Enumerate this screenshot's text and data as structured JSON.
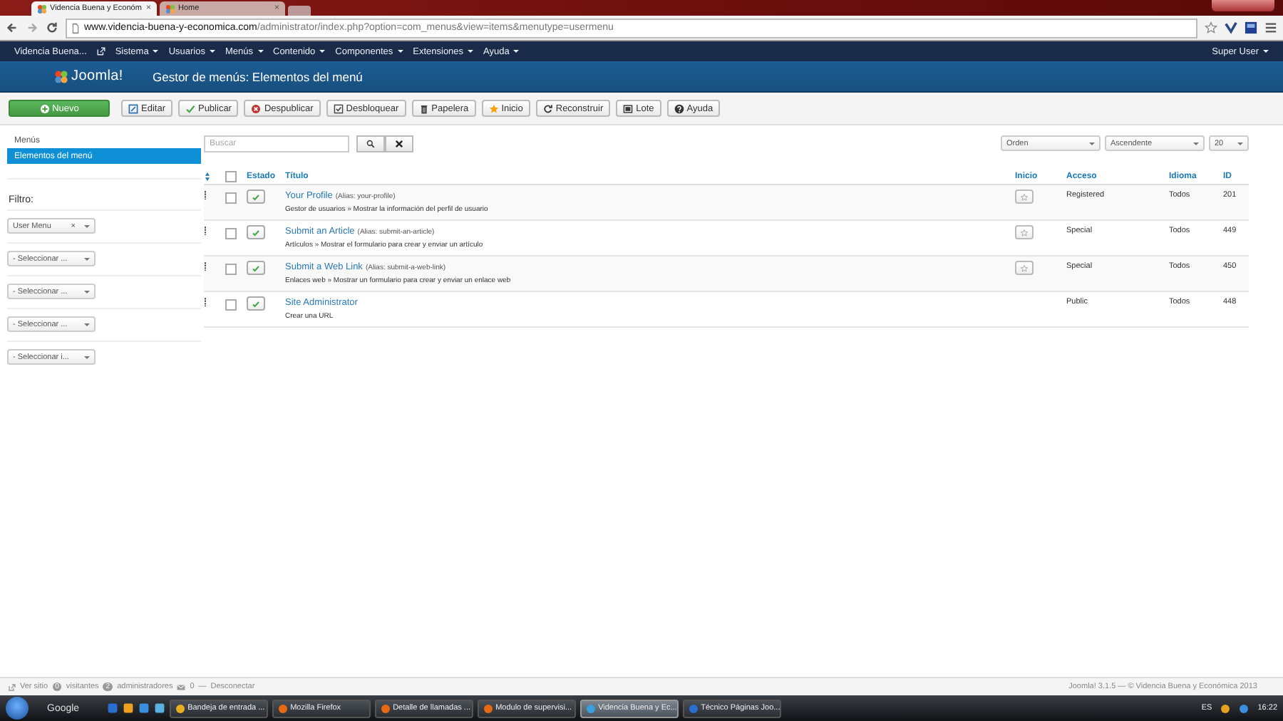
{
  "browser": {
    "tabs": [
      {
        "label": "Videncia Buena y Económ",
        "close": "×",
        "selected": true
      },
      {
        "label": "Home",
        "close": "×",
        "selected": false
      }
    ],
    "url": {
      "domain": "www.videncia-buena-y-economica.com",
      "path": "/administrator/index.php?option=com_menus&view=items&menutype=usermenu"
    }
  },
  "nav": {
    "site": "Videncia Buena...",
    "menus": [
      "Sistema",
      "Usuarios",
      "Menús",
      "Contenido",
      "Componentes",
      "Extensiones",
      "Ayuda"
    ],
    "user": "Super User"
  },
  "header": {
    "logo": "Joomla!",
    "title": "Gestor de menús: Elementos del menú"
  },
  "toolbar": [
    {
      "label": "Nuevo",
      "kind": "new"
    },
    {
      "label": "Editar",
      "kind": "edit"
    },
    {
      "label": "Publicar",
      "kind": "publish"
    },
    {
      "label": "Despublicar",
      "kind": "unpublish"
    },
    {
      "label": "Desbloquear",
      "kind": "checkin"
    },
    {
      "label": "Papelera",
      "kind": "trash"
    },
    {
      "label": "Inicio",
      "kind": "home"
    },
    {
      "label": "Reconstruir",
      "kind": "rebuild"
    },
    {
      "label": "Lote",
      "kind": "batch"
    },
    {
      "label": "Ayuda",
      "kind": "help"
    }
  ],
  "sidebar": {
    "items": [
      {
        "label": "Menús",
        "selected": false
      },
      {
        "label": "Elementos del menú",
        "selected": true
      }
    ],
    "filter_label": "Filtro:",
    "filters": [
      {
        "value": "User Menu",
        "clear": "×"
      },
      {
        "value": "- Seleccionar ..."
      },
      {
        "value": "- Seleccionar ..."
      },
      {
        "value": "- Seleccionar ..."
      },
      {
        "value": "- Seleccionar i..."
      }
    ]
  },
  "search": {
    "placeholder": "Buscar"
  },
  "list_controls": [
    "Orden",
    "Ascendente",
    "20"
  ],
  "table": {
    "select_all_checked": false,
    "columns": [
      "Estado",
      "Título",
      "Inicio",
      "Acceso",
      "Idioma",
      "ID"
    ],
    "rows": [
      {
        "title": "Your Profile",
        "alias": "(Alias: your-profile)",
        "description": "Gestor de usuarios » Mostrar la información del perfil de usuario",
        "checked": false,
        "published": true,
        "home_button": true,
        "access": "Registered",
        "language": "Todos",
        "id": "201"
      },
      {
        "title": "Submit an Article",
        "alias": "(Alias: submit-an-article)",
        "description": "Artículos » Mostrar el formulario para crear y enviar un artículo",
        "checked": false,
        "published": true,
        "home_button": true,
        "access": "Special",
        "language": "Todos",
        "id": "449"
      },
      {
        "title": "Submit a Web Link",
        "alias": "(Alias: submit-a-web-link)",
        "description": "Enlaces web » Mostrar un formulario para crear y enviar un enlace web",
        "checked": false,
        "published": true,
        "home_button": true,
        "access": "Special",
        "language": "Todos",
        "id": "450"
      },
      {
        "title": "Site Administrator",
        "alias": "",
        "description": "Crear una URL",
        "checked": false,
        "published": true,
        "home_button": false,
        "access": "Public",
        "language": "Todos",
        "id": "448"
      }
    ]
  },
  "status_bar": {
    "view_site": "Ver sitio",
    "visitors_count": "0",
    "visitors": "visitantes",
    "admins_count": "2",
    "admins": "administradores",
    "messages_count": "0",
    "separator": "—",
    "logout": "Desconectar",
    "copyright": "Joomla! 3.1.5 — © Videncia Buena y Económica 2013"
  },
  "taskbar": {
    "search": "Google",
    "tasks": [
      {
        "label": "Bandeja de entrada ...",
        "selected": false
      },
      {
        "label": "Mozilla Firefox",
        "selected": false
      },
      {
        "label": "Detalle de llamadas ...",
        "selected": false
      },
      {
        "label": "Modulo de supervisi...",
        "selected": false
      },
      {
        "label": "Videncia Buena y Ec...",
        "selected": true
      },
      {
        "label": "Técnico Páginas Joo...",
        "selected": false
      }
    ],
    "language": "ES",
    "clock": "16:22"
  }
}
